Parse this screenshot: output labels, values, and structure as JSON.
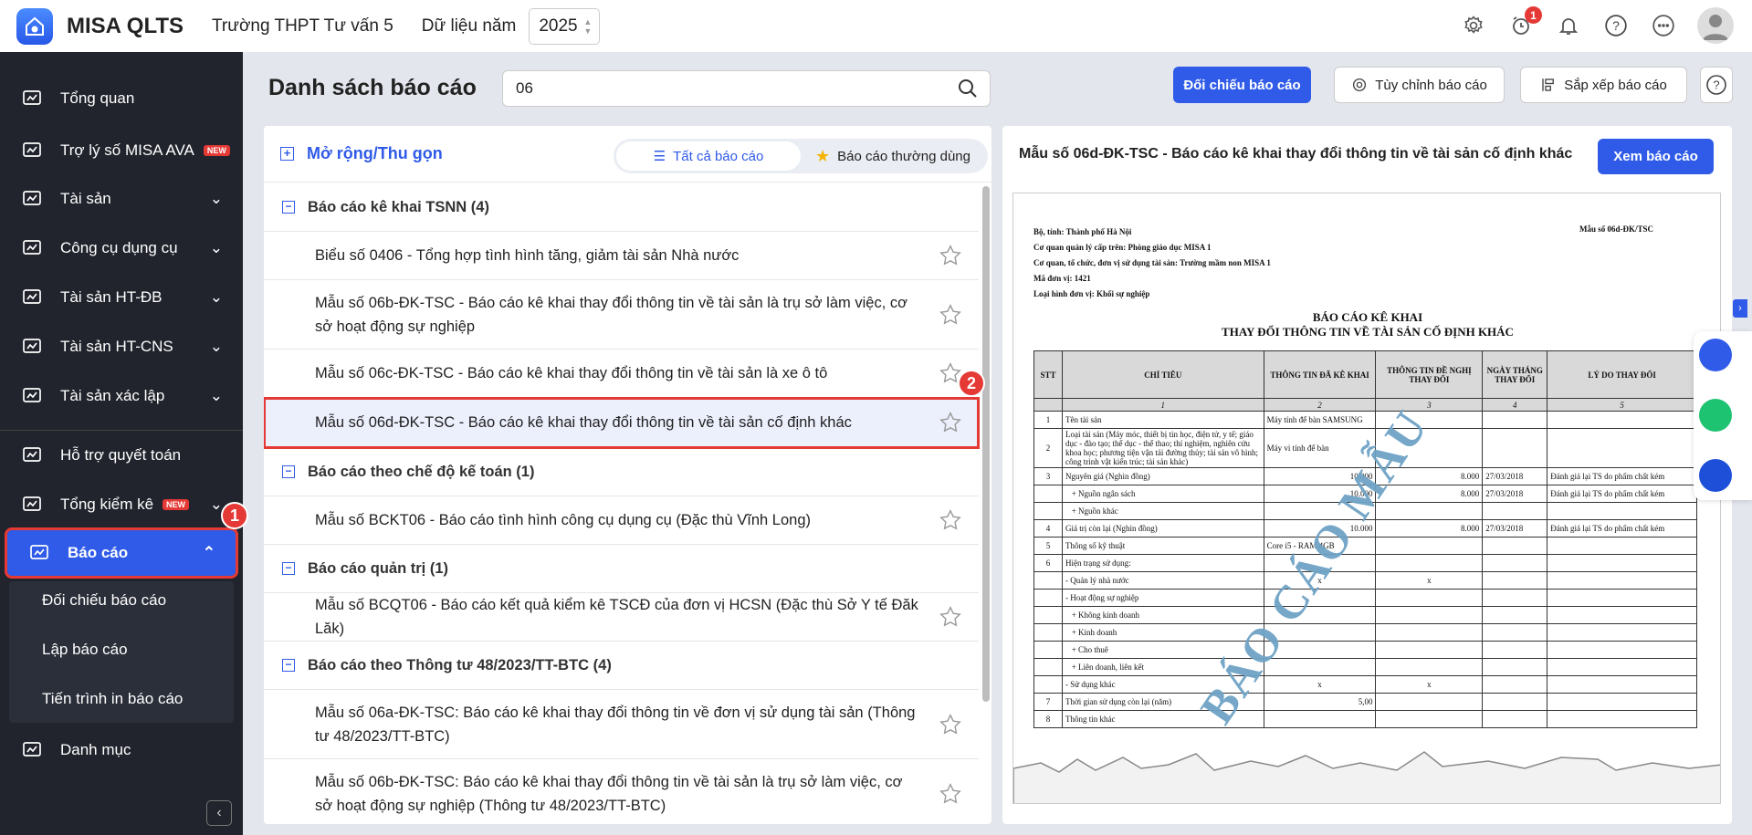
{
  "app": {
    "name": "MISA QLTS",
    "school": "Trường THPT Tư vấn 5",
    "year_label": "Dữ liệu năm",
    "year": "2025",
    "notification_count": "1"
  },
  "topbar_icons": [
    "gear-icon",
    "alarm-clock-icon",
    "bell-icon",
    "help-icon",
    "more-icon",
    "avatar"
  ],
  "sidebar": {
    "items": [
      {
        "label": "Tổng quan",
        "icon": "chart-monitor-icon"
      },
      {
        "label": "Trợ lý số MISA AVA",
        "icon": "sparkle-icon",
        "badge": "NEW"
      },
      {
        "label": "Tài sản",
        "icon": "car-icon",
        "chevron": true
      },
      {
        "label": "Công cụ dụng cụ",
        "icon": "tools-icon",
        "chevron": true
      },
      {
        "label": "Tài sản HT-ĐB",
        "icon": "road-icon",
        "chevron": true
      },
      {
        "label": "Tài sản HT-CNS",
        "icon": "faucet-icon",
        "chevron": true
      },
      {
        "label": "Tài sản xác lập",
        "icon": "car-icon",
        "chevron": true
      },
      {
        "label": "Hỗ trợ quyết toán",
        "icon": "clipboard-check-icon"
      },
      {
        "label": "Tổng kiểm kê",
        "icon": "file-check-icon",
        "badge": "NEW",
        "chevron": true
      },
      {
        "label": "Báo cáo",
        "icon": "bar-chart-icon",
        "active": true
      },
      {
        "label": "Danh mục",
        "icon": "list-icon"
      }
    ],
    "sub_items": [
      "Đối chiếu báo cáo",
      "Lập báo cáo",
      "Tiến trình in báo cáo"
    ]
  },
  "callouts": [
    "1",
    "2"
  ],
  "main": {
    "title": "Danh sách báo cáo",
    "search_value": "06",
    "buttons": {
      "compare": "Đối chiếu báo cáo",
      "customize": "Tùy chỉnh báo cáo",
      "sort": "Sắp xếp báo cáo"
    }
  },
  "list": {
    "expand_label": "Mở rộng/Thu gọn",
    "tabs": [
      "Tất cả báo cáo",
      "Báo cáo thường dùng"
    ],
    "rows": [
      {
        "type": "group",
        "label": "Báo cáo kê khai TSNN (4)"
      },
      {
        "type": "item",
        "label": "Biểu số 0406 - Tổng hợp tình hình tăng, giảm tài sản Nhà nước"
      },
      {
        "type": "item",
        "label": "Mẫu số 06b-ĐK-TSC - Báo cáo kê khai thay đổi thông tin về tài sản là trụ sở làm việc, cơ sở hoạt động sự nghiệp",
        "tall": true
      },
      {
        "type": "item",
        "label": "Mẫu số 06c-ĐK-TSC - Báo cáo kê khai thay đổi thông tin về tài sản là xe ô tô"
      },
      {
        "type": "item",
        "label": "Mẫu số 06d-ĐK-TSC - Báo cáo kê khai thay đổi thông tin về tài sản cố định khác",
        "selected": true
      },
      {
        "type": "group",
        "label": "Báo cáo theo chế độ kế toán (1)"
      },
      {
        "type": "item",
        "label": "Mẫu số BCKT06 - Báo cáo tình hình công cụ dụng cụ (Đặc thù Vĩnh Long)"
      },
      {
        "type": "group",
        "label": "Báo cáo quản trị (1)"
      },
      {
        "type": "item",
        "label": "Mẫu số BCQT06 - Báo cáo kết quả kiểm kê TSCĐ của đơn vị HCSN (Đặc thù Sở Y tế Đăk Lăk)"
      },
      {
        "type": "group",
        "label": "Báo cáo theo Thông tư 48/2023/TT-BTC (4)"
      },
      {
        "type": "item",
        "label": "Mẫu số 06a-ĐK-TSC: Báo cáo kê khai thay đổi thông tin về đơn vị sử dụng tài sản (Thông tư 48/2023/TT-BTC)",
        "tall": true
      },
      {
        "type": "item",
        "label": "Mẫu số 06b-ĐK-TSC: Báo cáo kê khai thay đổi thông tin về tài sản là trụ sở làm việc, cơ sở hoạt động sự nghiệp (Thông tư 48/2023/TT-BTC)",
        "tall": true
      }
    ]
  },
  "preview": {
    "title": "Mẫu số 06d-ĐK-TSC - Báo cáo kê khai thay đổi thông tin về tài sản cố định khác",
    "view_button": "Xem báo cáo",
    "doc": {
      "info": [
        "Bộ, tỉnh: Thành phố Hà Nội",
        "Cơ quan quản lý cấp trên: Phòng giáo dục MISA 1",
        "Cơ quan, tổ chức, đơn vị sử dụng tài sản: Trường mầm non MISA 1",
        "Mã đơn vị: 1421",
        "Loại hình đơn vị: Khối sự nghiệp"
      ],
      "form_no": "Mẫu số 06d-ĐK/TSC",
      "title1": "BÁO CÁO KÊ KHAI",
      "title2": "THAY ĐỔI THÔNG TIN VỀ TÀI SẢN CỐ ĐỊNH KHÁC",
      "watermark": "BÁO CÁO MẪU",
      "headers": [
        "STT",
        "CHỈ TIÊU",
        "THÔNG TIN ĐÃ KÊ KHAI",
        "THÔNG TIN ĐỀ NGHỊ THAY ĐỔI",
        "NGÀY THÁNG THAY ĐỔI",
        "LÝ DO THAY ĐỔI"
      ],
      "col_numbers": [
        "",
        "1",
        "2",
        "3",
        "4",
        "5"
      ],
      "rows": [
        [
          "1",
          "Tên tài sản",
          "Máy tính để bàn SAMSUNG",
          "",
          "",
          ""
        ],
        [
          "2",
          "Loại tài sản (Máy móc, thiết bị tin học, điện tử, y tế; giáo dục - đào tạo; thể dục - thể thao; thí nghiệm, nghiên cứu khoa học; phương tiện vận tải đường thủy; tài sản vô hình; công trình vật kiến trúc; tài sản khác)",
          "Máy vi tính để bàn",
          "",
          "",
          ""
        ],
        [
          "3",
          "Nguyên giá (Nghìn đồng)",
          "10.000",
          "8.000",
          "27/03/2018",
          "Đánh giá lại TS do phẩm chất kém"
        ],
        [
          "",
          "   + Nguồn ngân sách",
          "10.000",
          "8.000",
          "27/03/2018",
          "Đánh giá lại TS do phẩm chất kém"
        ],
        [
          "",
          "   + Nguồn khác",
          "",
          "",
          "",
          ""
        ],
        [
          "4",
          "Giá trị còn lại (Nghìn đồng)",
          "10.000",
          "8.000",
          "27/03/2018",
          "Đánh giá lại TS do phẩm chất kém"
        ],
        [
          "5",
          "Thông số kỹ thuật",
          "Core i5 - RAM 4GB",
          "",
          "",
          ""
        ],
        [
          "6",
          "Hiện trạng sử dụng:",
          "",
          "",
          "",
          ""
        ],
        [
          "",
          "- Quản lý nhà nước",
          "x",
          "x",
          "",
          ""
        ],
        [
          "",
          "- Hoạt động sự nghiệp",
          "",
          "",
          "",
          ""
        ],
        [
          "",
          "   + Không kinh doanh",
          "",
          "",
          "",
          ""
        ],
        [
          "",
          "   + Kinh doanh",
          "",
          "",
          "",
          ""
        ],
        [
          "",
          "   + Cho thuê",
          "",
          "",
          "",
          ""
        ],
        [
          "",
          "   + Liên doanh, liên kết",
          "",
          "",
          "",
          ""
        ],
        [
          "",
          "- Sử dụng khác",
          "x",
          "x",
          "",
          ""
        ],
        [
          "7",
          "Thời gian sử dụng còn lại (năm)",
          "5,00",
          "",
          "",
          ""
        ],
        [
          "8",
          "Thông tin khác",
          "",
          "",
          "",
          ""
        ]
      ]
    }
  },
  "colors": {
    "primary": "#2f5be8",
    "sidebar": "#21242d",
    "highlight": "#e53935",
    "watermark": "#6fa3c6"
  }
}
